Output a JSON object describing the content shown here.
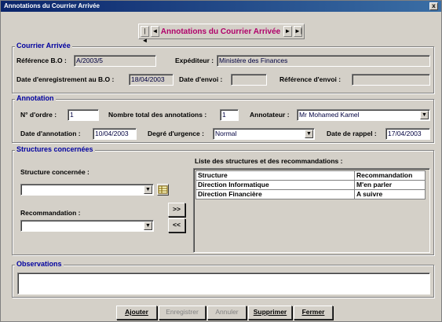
{
  "window": {
    "title": "Annotations du Courrier Arrivée",
    "close_glyph": "x"
  },
  "nav": {
    "title": "Annotations du Courrier Arrivée",
    "first_glyph": "|◄",
    "prev_glyph": "◄",
    "next_glyph": "►",
    "last_glyph": "►|"
  },
  "courrier": {
    "group_label": "Courrier Arrivée",
    "reference_label": "Référence B.O :",
    "reference_value": "A/2003/5",
    "expediteur_label": "Expéditeur :",
    "expediteur_value": "Ministère des Finances",
    "date_enreg_label": "Date d'enregistrement au B.O :",
    "date_enreg_value": "18/04/2003",
    "date_envoi_label": "Date d'envoi :",
    "date_envoi_value": "",
    "ref_envoi_label": "Référence d'envoi :",
    "ref_envoi_value": ""
  },
  "annotation": {
    "group_label": "Annotation",
    "ordre_label": "N° d'ordre :",
    "ordre_value": "1",
    "total_label": "Nombre total des annotations :",
    "total_value": "1",
    "annotateur_label": "Annotateur :",
    "annotateur_value": "Mr Mohamed Kamel",
    "date_annot_label": "Date d'annotation :",
    "date_annot_value": "10/04/2003",
    "urgence_label": "Degré d'urgence :",
    "urgence_value": "Normal",
    "rappel_label": "Date de rappel :",
    "rappel_value": "17/04/2003"
  },
  "structures": {
    "group_label": "Structures concernées",
    "structure_label": "Structure concernée :",
    "structure_value": "",
    "recommandation_label": "Recommandation :",
    "recommandation_value": "",
    "add_glyph": ">>",
    "remove_glyph": "<<",
    "list_title": "Liste des structures et des recommandations :",
    "columns": [
      "Structure",
      "Recommandation"
    ],
    "rows": [
      [
        "Direction Informatique",
        "M'en parler"
      ],
      [
        "Direction Financière",
        "A suivre"
      ]
    ]
  },
  "observations": {
    "group_label": "Observations",
    "value": ""
  },
  "buttons": {
    "ajouter": "Ajouter",
    "enregistrer": "Enregistrer",
    "annuler": "Annuler",
    "supprimer": "Supprimer",
    "fermer": "Fermer"
  },
  "colors": {
    "nav_title": "#b0006a",
    "group_label": "#0000a0",
    "titlebar": "#0a246a"
  }
}
